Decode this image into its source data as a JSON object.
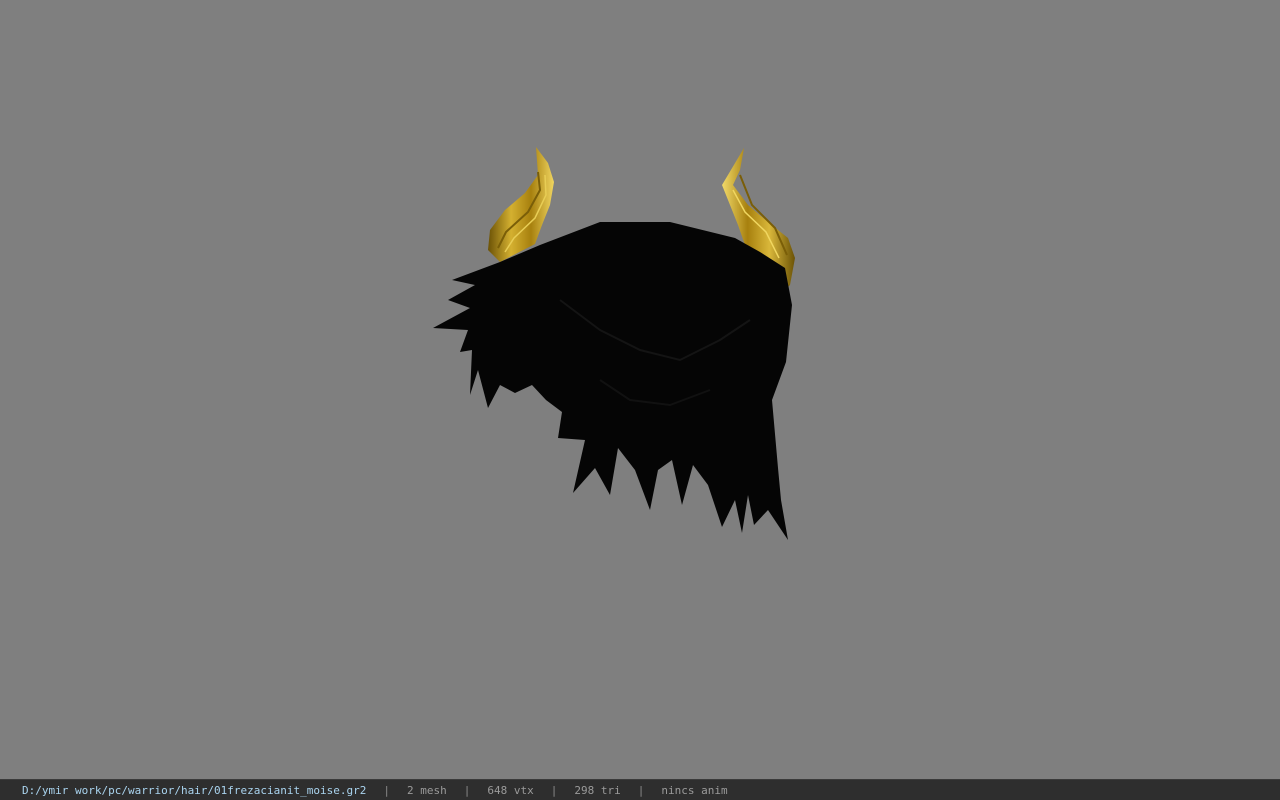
{
  "status": {
    "file_path": "D:/ymir work/pc/warrior/hair/01frezacianit_moise.gr2",
    "separator": "|",
    "mesh": "2 mesh",
    "vertices": "648 vtx",
    "triangles": "298 tri",
    "animation": "nincs anim"
  },
  "colors": {
    "background": "#7f7f7f",
    "statusbar": "#2e2e2e",
    "path_text": "#a9d3ee",
    "hair": "#050505",
    "horn_gold": "#c9a21a"
  },
  "icons": {
    "model": "hair-with-horns-model"
  }
}
